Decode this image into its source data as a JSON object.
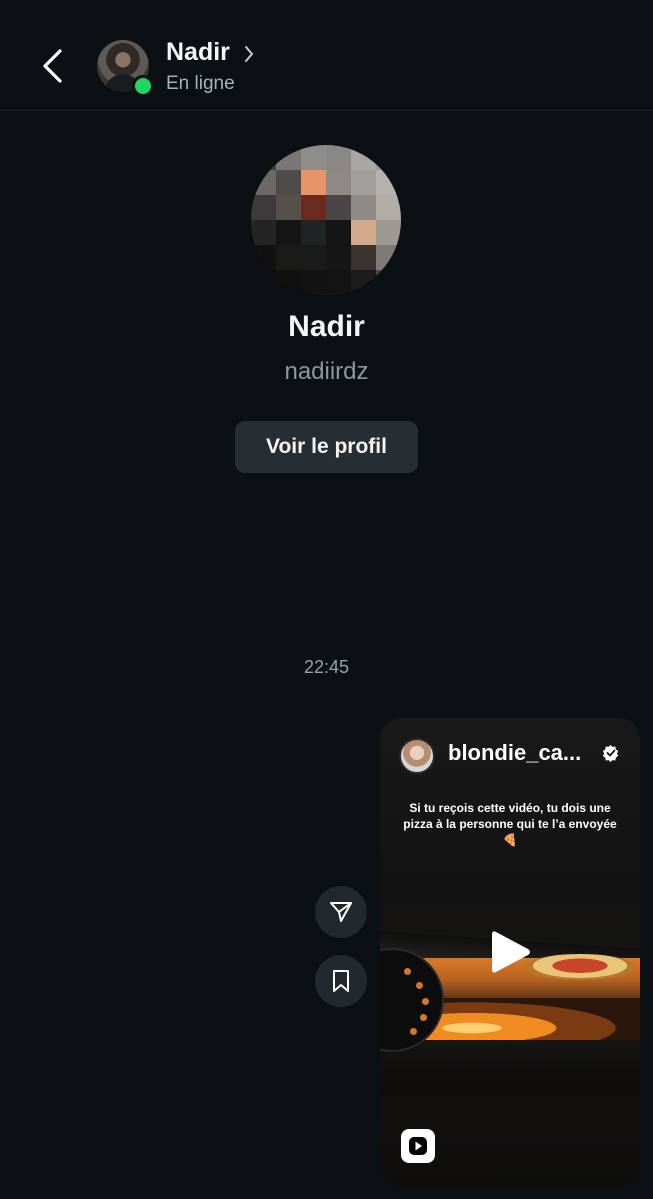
{
  "header": {
    "contact_name": "Nadir",
    "status": "En ligne"
  },
  "profile": {
    "name": "Nadir",
    "username": "nadiirdz",
    "view_profile_label": "Voir le profil"
  },
  "conversation": {
    "timestamp": "22:45"
  },
  "shared_reel": {
    "account": "blondie_ca...",
    "caption": "Si tu reçois cette vidéo, tu dois une pizza à la personne qui te l’a envoyée 🍕"
  },
  "icons": {
    "back": "chevron-left-icon",
    "header_chevron": "chevron-right-icon",
    "share": "paper-plane-icon",
    "save": "bookmark-icon",
    "play": "play-icon",
    "reel_badge": "reel-play-icon",
    "verified": "verified-badge-icon"
  },
  "colors": {
    "background": "#0b1014",
    "online": "#1ed760",
    "button_bg": "#262d33",
    "secondary_text": "#8e959c"
  }
}
